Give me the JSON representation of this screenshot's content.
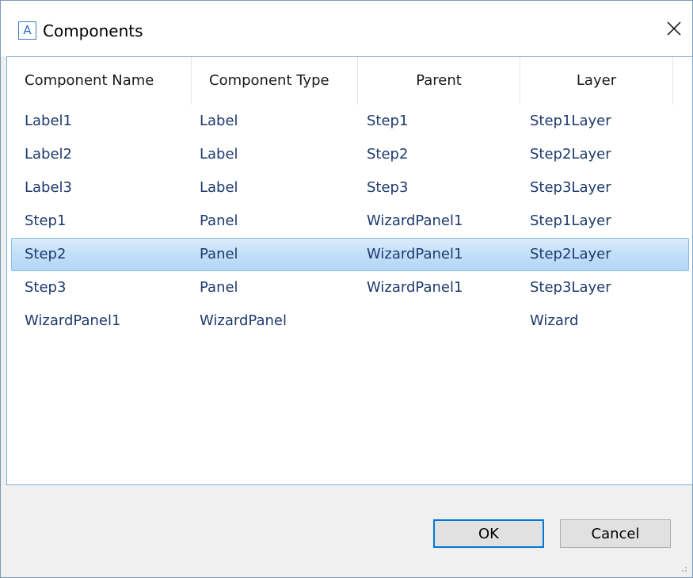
{
  "window": {
    "title": "Components",
    "app_icon_letter": "A"
  },
  "list": {
    "columns": [
      "Component Name",
      "Component Type",
      "Parent",
      "Layer"
    ],
    "rows": [
      {
        "name": "Label1",
        "type": "Label",
        "parent": "Step1",
        "layer": "Step1Layer",
        "selected": false
      },
      {
        "name": "Label2",
        "type": "Label",
        "parent": "Step2",
        "layer": "Step2Layer",
        "selected": false
      },
      {
        "name": "Label3",
        "type": "Label",
        "parent": "Step3",
        "layer": "Step3Layer",
        "selected": false
      },
      {
        "name": "Step1",
        "type": "Panel",
        "parent": "WizardPanel1",
        "layer": "Step1Layer",
        "selected": false
      },
      {
        "name": "Step2",
        "type": "Panel",
        "parent": "WizardPanel1",
        "layer": "Step2Layer",
        "selected": true
      },
      {
        "name": "Step3",
        "type": "Panel",
        "parent": "WizardPanel1",
        "layer": "Step3Layer",
        "selected": false
      },
      {
        "name": "WizardPanel1",
        "type": "WizardPanel",
        "parent": "",
        "layer": "Wizard",
        "selected": false
      }
    ]
  },
  "buttons": {
    "ok": "OK",
    "cancel": "Cancel"
  },
  "icons": {
    "close": "close-icon",
    "app": "app-icon",
    "resize": "resize-grip-icon"
  },
  "colors": {
    "cell_text": "#1e3a6e",
    "selection_top": "#dcecfc",
    "selection_bottom": "#b3d7f6",
    "selection_border": "#84bfe8",
    "default_button_border": "#0078d7"
  }
}
